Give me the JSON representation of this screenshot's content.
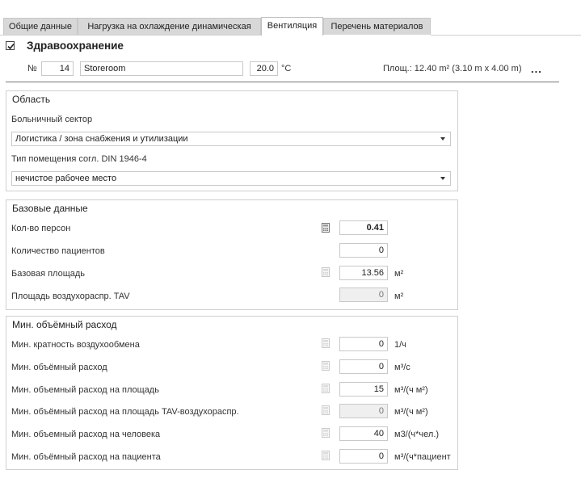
{
  "tabs": [
    {
      "label": "Общие данные",
      "active": false
    },
    {
      "label": "Нагрузка на охлаждение динамическая",
      "active": false
    },
    {
      "label": "Вентиляция",
      "active": true
    },
    {
      "label": "Перечень материалов",
      "active": false
    }
  ],
  "header": {
    "checked": true,
    "title": "Здравоохранение",
    "number_label": "№",
    "number": "14",
    "room_name": "Storeroom",
    "temperature": "20.0",
    "temperature_unit": "°C",
    "area_label": "Площ.:",
    "area_value": "12.40",
    "area_unit": "m²",
    "area_dims": "(3.10 m x 4.00 m)",
    "more_label": "..."
  },
  "region": {
    "title": "Область",
    "sector_label": "Больничный сектор",
    "sector_value": "Логистика / зона снабжения и утилизации",
    "room_type_label": "Тип помещения согл. DIN 1946-4",
    "room_type_value": "нечистое рабочее место"
  },
  "base": {
    "title": "Базовые данные",
    "rows": [
      {
        "label": "Кол-во персон",
        "value": "0.41",
        "unit": "",
        "calc": true,
        "disabled": false,
        "bold": true
      },
      {
        "label": "Количество пациентов",
        "value": "0",
        "unit": "",
        "calc": false,
        "disabled": false,
        "bold": false
      },
      {
        "label": "Базовая площадь",
        "value": "13.56",
        "unit": "м²",
        "calc": true,
        "disabled": false,
        "bold": false
      },
      {
        "label": "Площадь воздухораспр. TAV",
        "value": "0",
        "unit": "м²",
        "calc": false,
        "disabled": true,
        "bold": false
      }
    ]
  },
  "minflow": {
    "title": "Мин. объёмный расход",
    "rows": [
      {
        "label": "Мин. кратность воздухообмена",
        "value": "0",
        "unit": "1/ч",
        "disabled": false
      },
      {
        "label": "Мин. объёмный расход",
        "value": "0",
        "unit": "м³/с",
        "disabled": false
      },
      {
        "label": "Мин. объемный расход на площадь",
        "value": "15",
        "unit": "м³/(ч м²)",
        "disabled": false
      },
      {
        "label": "Мин. объёмный расход на площадь TAV-воздухораспр.",
        "value": "0",
        "unit": "м³/(ч м²)",
        "disabled": true
      },
      {
        "label": "Мин. объемный расход на человека",
        "value": "40",
        "unit": "м3/(ч*чел.)",
        "disabled": false
      },
      {
        "label": "Мин. объёмный расход на пациента",
        "value": "0",
        "unit": "м³/(ч*пациент",
        "disabled": false
      }
    ]
  },
  "colors": {
    "tab_bg": "#d8d8d8",
    "active_tab_bg": "#ffffff",
    "border": "#cfcfcf",
    "disabled_field": "#efefef"
  }
}
